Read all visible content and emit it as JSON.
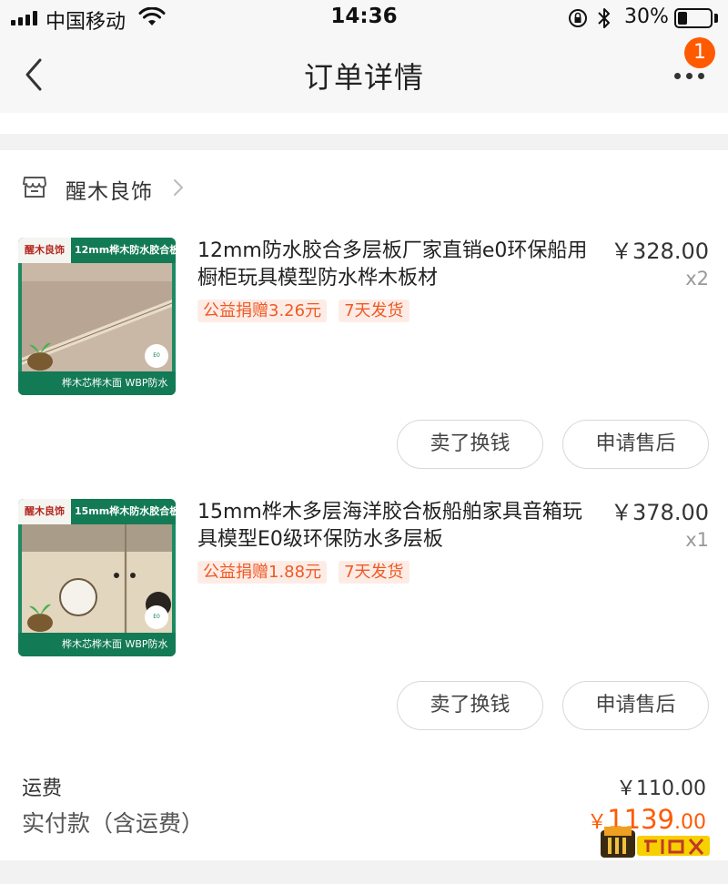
{
  "status_bar": {
    "carrier": "中国移动",
    "time": "14:36",
    "battery_percent": "30%",
    "battery_level": 0.3
  },
  "nav": {
    "title": "订单详情",
    "badge_count": "1"
  },
  "shop": {
    "name": "醒木良饰"
  },
  "items": [
    {
      "title": "12mm防水胶合多层板厂家直销e0环保船用橱柜玩具模型防水桦木板材",
      "price": "￥328.00",
      "quantity": "x2",
      "tags": [
        "公益捐赠3.26元",
        "7天发货"
      ],
      "thumb_logo": "醒木良饰",
      "thumb_caption": "12mm桦木防水胶合板",
      "thumb_footer": "桦木芯桦木面 WBP防水",
      "sell_button": "卖了换钱",
      "aftersale_button": "申请售后"
    },
    {
      "title": "15mm桦木多层海洋胶合板船舶家具音箱玩具模型E0级环保防水多层板",
      "price": "￥378.00",
      "quantity": "x1",
      "tags": [
        "公益捐赠1.88元",
        "7天发货"
      ],
      "thumb_logo": "醒木良饰",
      "thumb_caption": "15mm桦木防水胶合板",
      "thumb_footer": "桦木芯桦木面 WBP防水",
      "sell_button": "卖了换钱",
      "aftersale_button": "申请售后"
    }
  ],
  "summary": {
    "shipping_label": "运费",
    "shipping_value": "￥110.00",
    "paid_label": "实付款（含运费）",
    "paid_currency": "￥",
    "paid_integer": "1139",
    "paid_decimal": ".00"
  },
  "colors": {
    "accent": "#ff5a00",
    "tag_bg": "#fdece6",
    "thumb_green": "#137a56"
  }
}
